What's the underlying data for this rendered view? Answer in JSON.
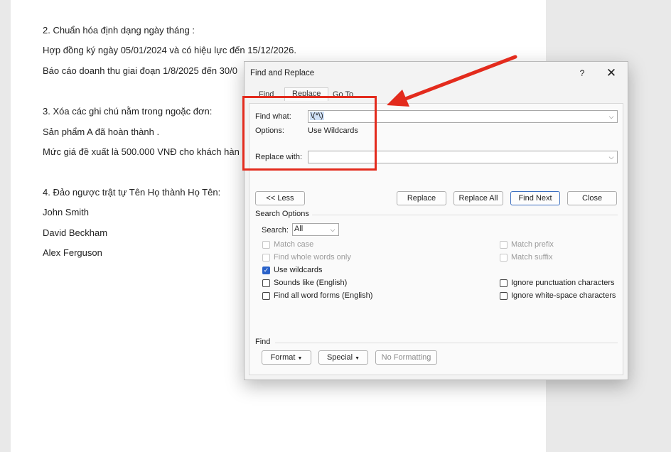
{
  "document": {
    "lines": [
      "2. Chuẩn hóa định dạng ngày tháng :",
      "Hợp đồng ký ngày  05/01/2024 và có hiệu lực đến  15/12/2026.",
      "Báo cáo doanh thu giai đoạn  1/8/2025 đến  30/0",
      "3. Xóa các ghi chú nằm trong ngoặc đơn:",
      "Sản phẩm A  đã hoàn thành .",
      "Mức giá đề xuất là 500.000 VNĐ  cho khách hàn",
      "4. Đảo ngược trật tự Tên Họ thành Họ Tên:",
      "John Smith",
      "David Beckham",
      "Alex Ferguson"
    ]
  },
  "dialog": {
    "title": "Find and Replace",
    "help": "?",
    "close": "✕",
    "tabs": [
      "Find",
      "Replace",
      "Go To"
    ],
    "active_tab": "Replace",
    "find_what_label": "Find what:",
    "find_what_value": "\\(*\\)",
    "options_label": "Options:",
    "options_value": "Use Wildcards",
    "replace_with_label": "Replace with:",
    "replace_with_value": "",
    "buttons": {
      "less": "<< Less",
      "replace": "Replace",
      "replace_all": "Replace All",
      "find_next": "Find Next",
      "close": "Close"
    },
    "search_options_label": "Search Options",
    "search_label": "Search:",
    "search_value": "All",
    "checkboxes": {
      "match_case": "Match case",
      "find_whole_words": "Find whole words only",
      "use_wildcards": "Use wildcards",
      "sounds_like": "Sounds like (English)",
      "find_all_word_forms": "Find all word forms (English)",
      "match_prefix": "Match prefix",
      "match_suffix": "Match suffix",
      "ignore_punctuation": "Ignore punctuation characters",
      "ignore_whitespace": "Ignore white-space characters"
    },
    "find_section_label": "Find",
    "format_button": "Format",
    "special_button": "Special",
    "no_formatting_button": "No Formatting"
  },
  "colors": {
    "annotation": "#e32b1d",
    "accent": "#2a62c9"
  }
}
